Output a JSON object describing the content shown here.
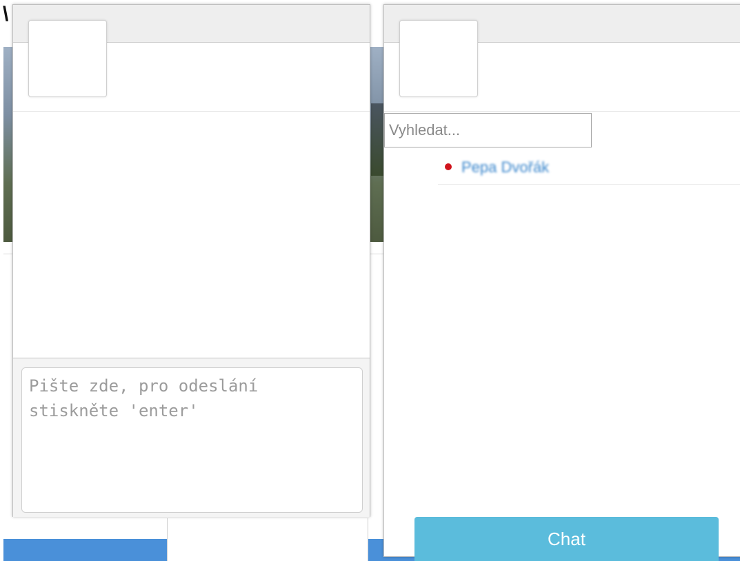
{
  "chat": {
    "input_placeholder": "Pište zde, pro odeslání stiskněte 'enter'",
    "input_value": ""
  },
  "contacts": {
    "search_placeholder": "Vyhledat...",
    "search_value": "",
    "items": [
      {
        "name": "Pepa Dvořák",
        "status": "offline",
        "status_color": "#d0141c"
      }
    ]
  },
  "chat_launcher": {
    "label": "Chat"
  },
  "colors": {
    "accent": "#5bbcdc",
    "link": "#3a86cc",
    "status_offline": "#d0141c"
  }
}
